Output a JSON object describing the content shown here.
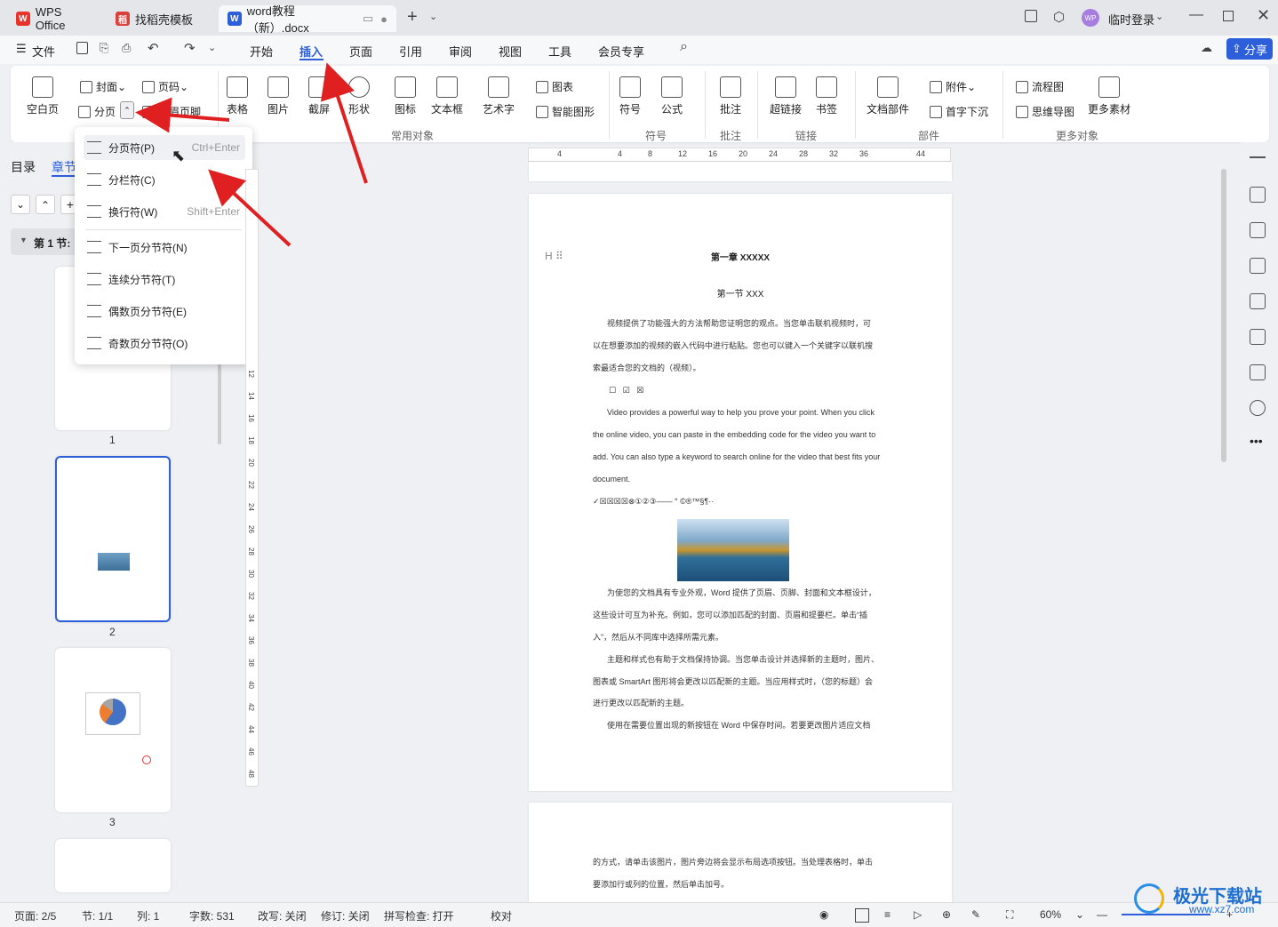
{
  "tabs": [
    {
      "label": "WPS Office",
      "icon": "wps-icon"
    },
    {
      "label": "找稻壳模板",
      "icon": "daoke-icon"
    },
    {
      "label": "word教程（新）.docx",
      "icon": "word-doc-icon"
    }
  ],
  "user": {
    "avatar": "WP",
    "login": "临时登录"
  },
  "menu": {
    "file": "文件",
    "items": [
      "开始",
      "插入",
      "页面",
      "引用",
      "审阅",
      "视图",
      "工具",
      "会员专享"
    ],
    "active": "插入",
    "share": "分享"
  },
  "ribbon": {
    "blank_page": "空白页",
    "cover": "封面",
    "page_break": "分页",
    "page_num": "页码",
    "header_footer": "页眉页脚",
    "table": "表格",
    "picture": "图片",
    "screenshot": "截屏",
    "shape": "形状",
    "icon": "图标",
    "textbox": "文本框",
    "art_text": "艺术字",
    "chart": "图表",
    "smart_shape": "智能图形",
    "symbol": "符号",
    "formula": "公式",
    "comment": "批注",
    "hyperlink": "超链接",
    "bookmark": "书签",
    "doc_parts": "文档部件",
    "attachment": "附件",
    "drop_cap": "首字下沉",
    "flowchart": "流程图",
    "mindmap": "思维导图",
    "more_material": "更多素材",
    "groups": {
      "common": "常用对象",
      "symbol": "符号",
      "comment": "批注",
      "link": "链接",
      "parts": "部件",
      "more": "更多对象"
    }
  },
  "dropdown": [
    {
      "label": "分页符(P)",
      "shortcut": "Ctrl+Enter"
    },
    {
      "label": "分栏符(C)",
      "shortcut": ""
    },
    {
      "label": "换行符(W)",
      "shortcut": "Shift+Enter"
    },
    {
      "label": "下一页分节符(N)",
      "shortcut": ""
    },
    {
      "label": "连续分节符(T)",
      "shortcut": ""
    },
    {
      "label": "偶数页分节符(E)",
      "shortcut": ""
    },
    {
      "label": "奇数页分节符(O)",
      "shortcut": ""
    }
  ],
  "nav": {
    "toc": "目录",
    "chapter": "章节",
    "section": "第 1 节:",
    "pages": [
      "1",
      "2",
      "3"
    ]
  },
  "ruler": {
    "h": [
      "4",
      "4",
      "8",
      "12",
      "16",
      "20",
      "24",
      "28",
      "32",
      "36",
      "44"
    ],
    "v": [
      "12",
      "14",
      "16",
      "18",
      "20",
      "22",
      "24",
      "26",
      "28",
      "30",
      "32",
      "34",
      "36",
      "38",
      "40",
      "42",
      "44",
      "46",
      "48"
    ]
  },
  "doc": {
    "chapter": "第一章 XXXXX",
    "section": "第一节 XXX",
    "p1a": "视频提供了功能强大的方法帮助您证明您的观点。当您单击联机视频时，可",
    "p1b": "以在想要添加的视频的嵌入代码中进行粘贴。您也可以键入一个关键字以联机搜",
    "p1c": "索最适合您的文档的（视频）。",
    "en1": "Video provides a powerful way to help you prove your point. When you click",
    "en2": "the online video, you can paste in the embedding code for the video you want to",
    "en3": "add. You can also type a keyword to search online for the video that best fits your",
    "en4": "document.",
    "symbols": "✓☒☒☒☒⊗①②③——  ° ©®™§¶··",
    "p2a": "为使您的文档具有专业外观，Word 提供了页眉、页脚、封面和文本框设计，",
    "p2b": "这些设计可互为补充。例如，您可以添加匹配的封面、页眉和提要栏。单击“插",
    "p2c": "入”，然后从不同库中选择所需元素。",
    "p3a": "主题和样式也有助于文档保持协调。当您单击设计并选择新的主题时，图片、",
    "p3b": "图表或 SmartArt 图形将会更改以匹配新的主题。当应用样式时，（您的标题）会",
    "p3c": "进行更改以匹配新的主题。",
    "p4": "使用在需要位置出现的新按钮在 Word 中保存时间。若要更改图片适应文档",
    "pg2a": "的方式，请单击该图片，图片旁边将会显示布局选项按钮。当处理表格时，单击",
    "pg2b": "要添加行或列的位置，然后单击加号。"
  },
  "status": {
    "page": "页面: 2/5",
    "section": "节: 1/1",
    "col": "列: 1",
    "words": "字数: 531",
    "rev_mode": "改写: 关闭",
    "track": "修订: 关闭",
    "spell": "拼写检查: 打开",
    "proof": "校对",
    "zoom": "60%"
  },
  "watermark": {
    "name": "极光下载站",
    "url": "www.xz7.com"
  },
  "colors": {
    "accent": "#2c5fd9",
    "arrow": "#e02020",
    "wps_red": "#e8332a"
  }
}
